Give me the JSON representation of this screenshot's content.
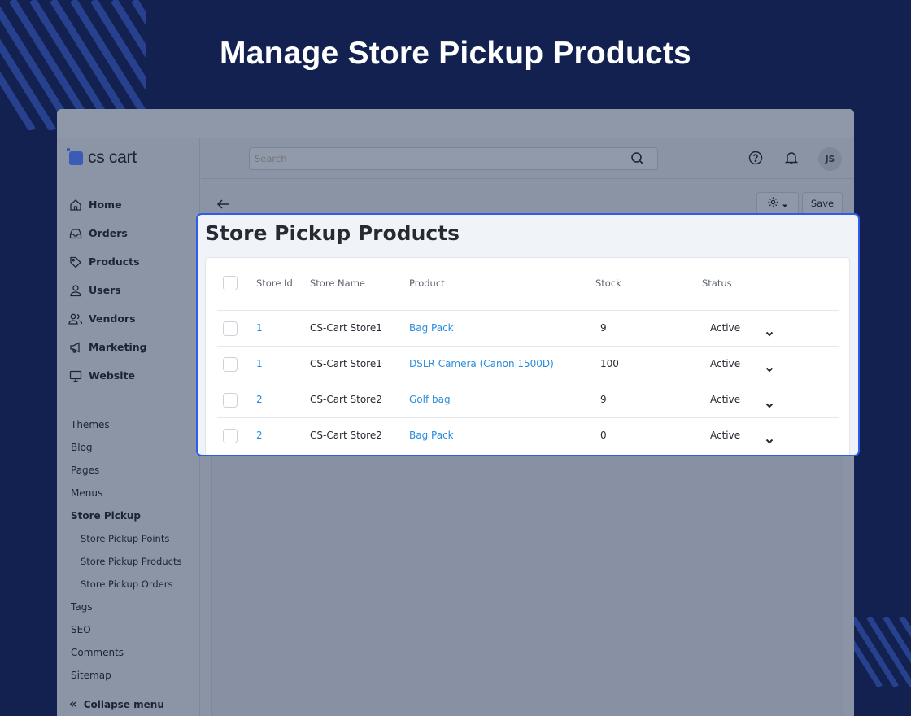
{
  "headline": "Manage Store Pickup Products",
  "brand": {
    "name": "cs cart"
  },
  "sidebar": {
    "main_items": [
      {
        "label": "Home",
        "icon": "home-icon"
      },
      {
        "label": "Orders",
        "icon": "inbox-icon"
      },
      {
        "label": "Products",
        "icon": "tag-icon"
      },
      {
        "label": "Users",
        "icon": "user-icon"
      },
      {
        "label": "Vendors",
        "icon": "users-icon"
      },
      {
        "label": "Marketing",
        "icon": "megaphone-icon"
      },
      {
        "label": "Website",
        "icon": "monitor-icon"
      }
    ],
    "website_items": [
      "Themes",
      "Blog",
      "Pages",
      "Menus",
      "Store Pickup"
    ],
    "store_pickup_items": [
      "Store Pickup Points",
      "Store Pickup Products",
      "Store Pickup Orders"
    ],
    "more_items": [
      "Tags",
      "SEO",
      "Comments",
      "Sitemap"
    ],
    "collapse_label": "Collapse menu"
  },
  "topbar": {
    "search_placeholder": "Search",
    "avatar_initials": "JS"
  },
  "toolbar": {
    "save_label": "Save"
  },
  "page": {
    "title": "Store Pickup Products",
    "columns": {
      "store_id": "Store Id",
      "store_name": "Store Name",
      "product": "Product",
      "stock": "Stock",
      "status": "Status"
    },
    "rows": [
      {
        "store_id": "1",
        "store_name": "CS-Cart Store1",
        "product": "Bag Pack",
        "stock": "9",
        "status": "Active"
      },
      {
        "store_id": "1",
        "store_name": "CS-Cart Store1",
        "product": "DSLR Camera (Canon 1500D)",
        "stock": "100",
        "status": "Active"
      },
      {
        "store_id": "2",
        "store_name": "CS-Cart Store2",
        "product": "Golf bag",
        "stock": "9",
        "status": "Active"
      },
      {
        "store_id": "2",
        "store_name": "CS-Cart Store2",
        "product": "Bag Pack",
        "stock": "0",
        "status": "Active"
      }
    ]
  },
  "colors": {
    "background": "#12214f",
    "highlight_border": "#2f5ce8",
    "link": "#2a8cdc",
    "brand": "#3a5bb8"
  }
}
